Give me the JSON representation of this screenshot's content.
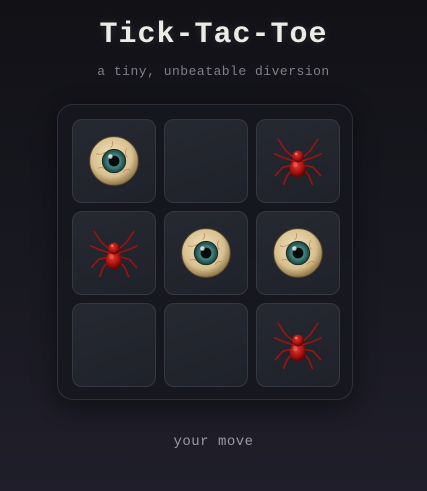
{
  "header": {
    "title": "Tick-Tac-Toe",
    "subtitle": "a tiny, unbeatable diversion"
  },
  "board": {
    "cells": [
      {
        "mark": "eye"
      },
      {
        "mark": "empty"
      },
      {
        "mark": "spider"
      },
      {
        "mark": "spider"
      },
      {
        "mark": "eye"
      },
      {
        "mark": "eye"
      },
      {
        "mark": "empty"
      },
      {
        "mark": "empty"
      },
      {
        "mark": "spider"
      }
    ]
  },
  "icons": {
    "eye": "eyeball-icon",
    "spider": "spider-icon"
  },
  "colors": {
    "spider": "#b01818",
    "iris": "#2f6f6a",
    "sclera": "#e6d3a8"
  },
  "status": {
    "text": "your move"
  }
}
